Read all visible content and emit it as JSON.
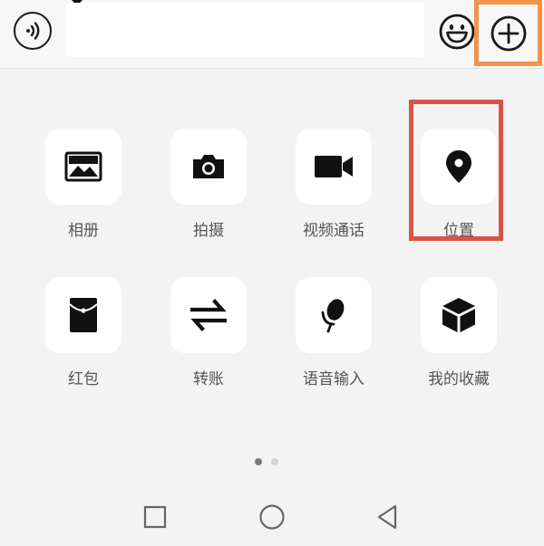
{
  "input_bar": {
    "text_value": "",
    "voice_icon": "voice-icon",
    "emoji_icon": "smiley-icon",
    "plus_icon": "plus-circle-icon"
  },
  "panel": {
    "row1": [
      {
        "label": "相册",
        "icon": "photo-album-icon"
      },
      {
        "label": "拍摄",
        "icon": "camera-icon"
      },
      {
        "label": "视频通话",
        "icon": "video-call-icon"
      },
      {
        "label": "位置",
        "icon": "location-pin-icon"
      }
    ],
    "row2": [
      {
        "label": "红包",
        "icon": "red-packet-icon"
      },
      {
        "label": "转账",
        "icon": "transfer-icon"
      },
      {
        "label": "语音输入",
        "icon": "microphone-icon"
      },
      {
        "label": "我的收藏",
        "icon": "favorites-box-icon"
      }
    ]
  },
  "pager": {
    "current_page": 1,
    "total_pages": 2
  },
  "colors": {
    "plus_highlight": "#f0944a",
    "location_highlight": "#d9534a",
    "dot_active": "#7a7a7a",
    "dot_inactive": "#d4d4d4"
  },
  "navbar": {
    "square_icon": "recent-apps-icon",
    "circle_icon": "home-icon",
    "triangle_icon": "back-icon"
  }
}
